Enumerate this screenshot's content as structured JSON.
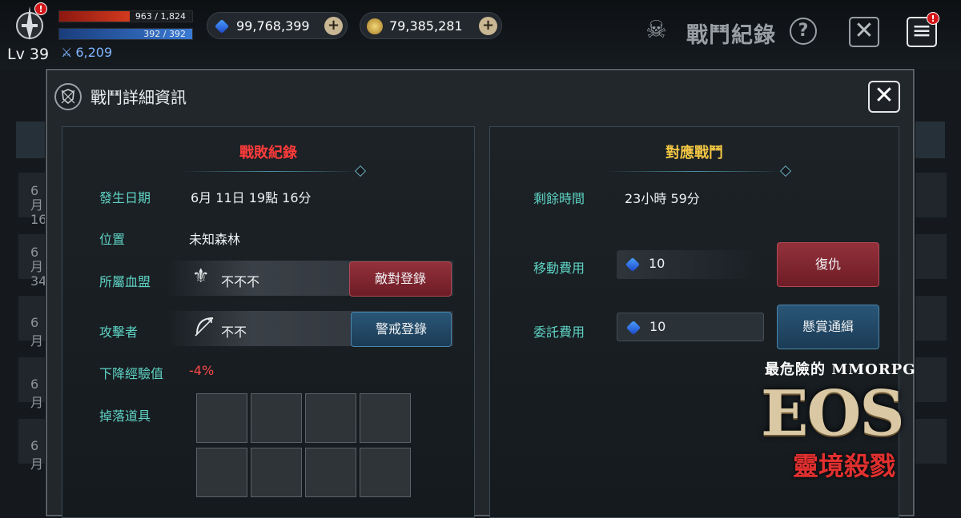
{
  "hud": {
    "hp_text": "963 / 1,824",
    "hp_fraction": 0.528,
    "mp_text": "392 / 392",
    "mp_fraction": 1.0,
    "level": "Lv 39",
    "combat_power": "6,209",
    "gems": "99,768,399",
    "gold": "79,385,281",
    "title": "戰鬥紀錄",
    "help_icon": "?",
    "close_icon": "✕",
    "menu_icon": "≡",
    "badge": "!"
  },
  "background_list": [
    "6月\n16",
    "6月\n34",
    "6月",
    "6月",
    "6月"
  ],
  "modal": {
    "title": "戰鬥詳細資訊",
    "close_label": "✕",
    "left": {
      "title": "戰敗紀錄",
      "date_label": "發生日期",
      "date_value": "6月 11日 19點 16分",
      "location_label": "位置",
      "location_value": "未知森林",
      "guild_label": "所屬血盟",
      "guild_value": "不不不",
      "hostile_button": "敵對登錄",
      "attacker_label": "攻擊者",
      "attacker_value": "不不",
      "alert_button": "警戒登錄",
      "exp_label": "下降經驗值",
      "exp_value": "-4%",
      "drop_label": "掉落道具"
    },
    "right": {
      "title": "對應戰鬥",
      "time_label": "剩餘時間",
      "time_value": "23小時 59分",
      "move_cost_label": "移動費用",
      "move_cost_value": "10",
      "revenge_button": "復仇",
      "commission_label": "委託費用",
      "commission_value": "10",
      "bounty_button": "懸賞通緝"
    }
  },
  "logo": {
    "tagline": "最危險的 MMORPG",
    "main": "EOS",
    "sub": "靈境殺戮"
  },
  "colors": {
    "defeat_title": "#ff3b3b",
    "battle_title": "#f2c644",
    "label": "#5fd3c5",
    "exp_loss": "#ff4a4a"
  }
}
